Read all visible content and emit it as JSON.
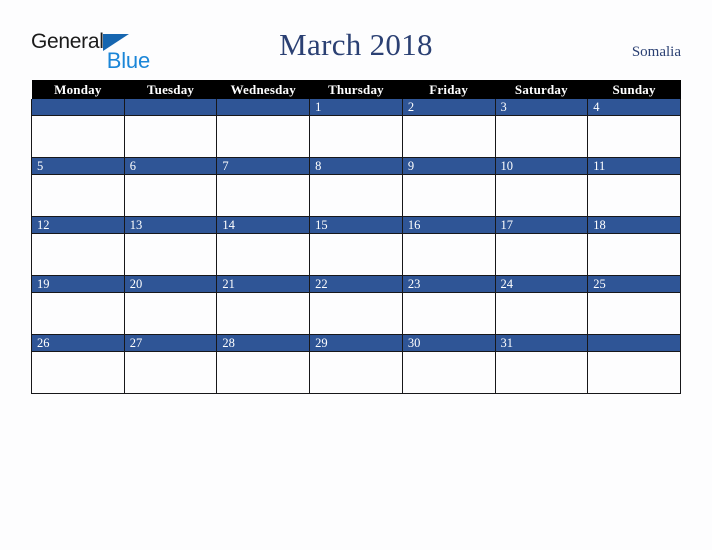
{
  "brand": {
    "name_part1": "General",
    "name_part2": "Blue",
    "triangle_icon": "triangle-icon",
    "accent_dark": "#1666b0",
    "accent_light": "#1b86d8"
  },
  "header": {
    "title": "March 2018",
    "country": "Somalia",
    "title_color": "#2b4073"
  },
  "calendar": {
    "month": "March",
    "year": "2018",
    "weekday_headers": [
      "Monday",
      "Tuesday",
      "Wednesday",
      "Thursday",
      "Friday",
      "Saturday",
      "Sunday"
    ],
    "header_bg": "#000000",
    "daynum_bg": "#2f5596",
    "cell_bg": "#fdfdfe",
    "border_color": "#17171a",
    "weeks": [
      [
        "",
        "",
        "",
        "1",
        "2",
        "3",
        "4"
      ],
      [
        "5",
        "6",
        "7",
        "8",
        "9",
        "10",
        "11"
      ],
      [
        "12",
        "13",
        "14",
        "15",
        "16",
        "17",
        "18"
      ],
      [
        "19",
        "20",
        "21",
        "22",
        "23",
        "24",
        "25"
      ],
      [
        "26",
        "27",
        "28",
        "29",
        "30",
        "31",
        ""
      ]
    ]
  }
}
